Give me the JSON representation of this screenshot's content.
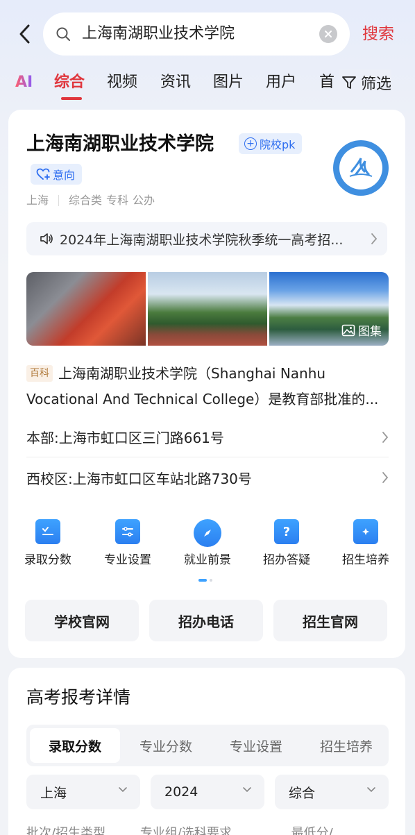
{
  "search": {
    "query": "上海南湖职业技术学院",
    "button_label": "搜索"
  },
  "tabs": {
    "ai": "AI",
    "items": [
      "综合",
      "视频",
      "资讯",
      "图片",
      "用户",
      "首"
    ],
    "filter_label": "筛选"
  },
  "school": {
    "name": "上海南湖职业技术学院",
    "pk_label": "院校pk",
    "intent_label": "意向",
    "city": "上海",
    "tags": [
      "综合类",
      "专科",
      "公办"
    ],
    "notice": "2024年上海南湖职业技术学院秋季统一高考招..."
  },
  "gallery": {
    "label": "图集"
  },
  "baike": {
    "tag": "百科",
    "text": "上海南湖职业技术学院（Shanghai Nanhu Vocational And Technical College）是教育部批准的..."
  },
  "addresses": [
    "本部:上海市虹口区三门路661号",
    "西校区:上海市虹口区车站北路730号"
  ],
  "quick_links": [
    {
      "label": "录取分数",
      "icon": "score-icon"
    },
    {
      "label": "专业设置",
      "icon": "settings-icon"
    },
    {
      "label": "就业前景",
      "icon": "compass-icon"
    },
    {
      "label": "招办答疑",
      "icon": "question-icon"
    },
    {
      "label": "招生培养",
      "icon": "folder-icon"
    }
  ],
  "buttons": [
    "学校官网",
    "招办电话",
    "招生官网"
  ],
  "exam": {
    "title": "高考报考详情",
    "segments": [
      "录取分数",
      "专业分数",
      "专业设置",
      "招生培养"
    ],
    "filters": [
      "上海",
      "2024",
      "综合"
    ],
    "cut_row": [
      "批次/招生类型",
      "专业组/选科要求",
      "最低分/..."
    ]
  },
  "colors": {
    "accent": "#e0363d",
    "link_blue": "#2e6ef0"
  }
}
